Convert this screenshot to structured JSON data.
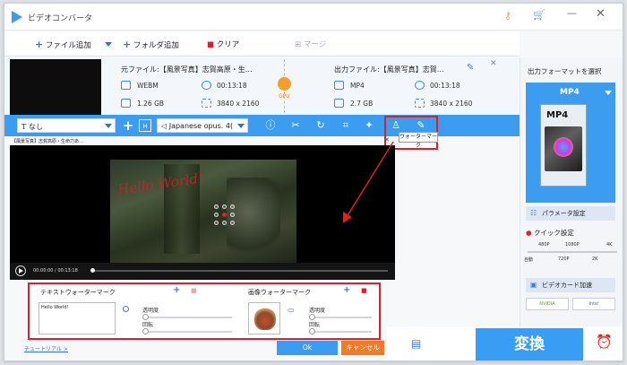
{
  "app": {
    "title": "ビデオコンバータ"
  },
  "toolbar": {
    "add_file": "ファイル追加",
    "add_folder": "フォルダ追加",
    "clear": "クリア",
    "merge": "マージ",
    "gpu": "GPU"
  },
  "source": {
    "label": "元ファイル:【風景写真】志賀高原・生…",
    "format": "WEBM",
    "duration": "00:13:18",
    "size": "1.26 GB",
    "resolution": "3840 x 2160"
  },
  "output": {
    "label": "出力ファイル:【風景写真】志賀…",
    "format": "MP4",
    "duration": "00:13:18",
    "size": "2.7 GB",
    "resolution": "3840 x 2160"
  },
  "editbar": {
    "subtitle": "なし",
    "audio": "Japanese opus. 4(",
    "tooltip": "ウォーターマーク"
  },
  "editor": {
    "caption": "【風景写真】志賀高原・生命力あ…",
    "watermark_text": "Hello World!",
    "time": "00:00:00 / 00:13:18"
  },
  "wmpanel": {
    "text_title": "テキストウォーターマーク",
    "text_value": "Hello World!",
    "transparency": "透明度",
    "rotation": "回転",
    "image_title": "画像ウォーターマーク"
  },
  "buttons": {
    "ok": "Ok",
    "cancel": "キャンセル",
    "tutorial": "チュートリアル >",
    "convert": "変換"
  },
  "right": {
    "select_format": "出力フォーマットを選択",
    "format": "MP4",
    "params": "パラメータ設定",
    "quick": "クイック設定",
    "q480": "480P",
    "q1080": "1080P",
    "q4k": "4K",
    "auto": "自動",
    "q720": "720P",
    "q2k": "2K",
    "gpu_accel": "ビデオカード加速",
    "nvidia": "NVIDIA",
    "intel": "Intel"
  },
  "colors": {
    "accent": "#3b9cf0",
    "highlight": "#d9232c",
    "orange": "#f17b29"
  }
}
